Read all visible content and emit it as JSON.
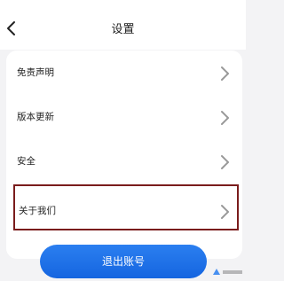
{
  "header": {
    "title": "设置",
    "back_icon": "back-arrow-icon"
  },
  "settings": {
    "items": [
      {
        "label": "免责声明",
        "icon": "chevron-right-icon"
      },
      {
        "label": "版本更新",
        "icon": "chevron-right-icon"
      },
      {
        "label": "安全",
        "icon": "chevron-right-icon"
      },
      {
        "label": "关于我们",
        "icon": "chevron-right-icon",
        "highlighted": true
      }
    ]
  },
  "actions": {
    "logout_label": "退出账号"
  },
  "colors": {
    "page_bg": "#f3f3f5",
    "card_bg": "#ffffff",
    "accent_blue": "#1a6ee8",
    "highlight_border": "#7a1c1c",
    "chevron": "#999999"
  }
}
